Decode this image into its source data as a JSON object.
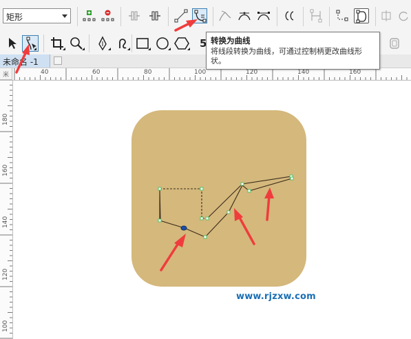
{
  "property_bar": {
    "shape_select": {
      "value": "矩形"
    },
    "buttons": [
      {
        "name": "add-node-icon"
      },
      {
        "name": "delete-node-icon"
      },
      {
        "name": "join-nodes-icon"
      },
      {
        "name": "break-curve-icon"
      },
      {
        "name": "convert-to-line-icon"
      },
      {
        "name": "convert-to-curve-icon",
        "active": true
      },
      {
        "name": "cusp-node-icon"
      },
      {
        "name": "smooth-node-icon"
      },
      {
        "name": "symmetrical-node-icon"
      },
      {
        "name": "reverse-direction-icon"
      },
      {
        "name": "extract-subpath-icon"
      },
      {
        "name": "extend-curve-icon"
      },
      {
        "name": "close-curve-icon"
      }
    ]
  },
  "toolbox": {
    "tools": [
      {
        "name": "pick-tool-icon"
      },
      {
        "name": "shape-tool-icon",
        "active": true
      },
      {
        "name": "crop-tool-icon"
      },
      {
        "name": "zoom-tool-icon"
      },
      {
        "name": "pen-tool-icon"
      },
      {
        "name": "artistic-media-icon"
      },
      {
        "name": "rectangle-tool-icon"
      },
      {
        "name": "ellipse-tool-icon"
      },
      {
        "name": "polygon-tool-icon"
      },
      {
        "name": "text-tool-icon"
      },
      {
        "name": "lock-icon"
      }
    ],
    "text_tool_glyph": "5"
  },
  "doc_tab": {
    "label": "未命名 -1"
  },
  "tooltip": {
    "title": "转换为曲线",
    "description": "将线段转换为曲线，可通过控制柄更改曲线形状。"
  },
  "ruler": {
    "horizontal_labels": [
      "40",
      "60",
      "80",
      "100",
      "120",
      "140",
      "160"
    ],
    "vertical_labels": [
      "180",
      "160",
      "140",
      "120",
      "100"
    ],
    "corner_label": "米"
  },
  "artwork": {
    "background_color": "#d4b87c",
    "path_color": "#3a2a1a",
    "node_color": "#58c06a",
    "selected_node_color": "#1b4fa8",
    "arrow_color": "#f03c3c"
  },
  "watermark": {
    "text": "www.rjzxw.com"
  }
}
